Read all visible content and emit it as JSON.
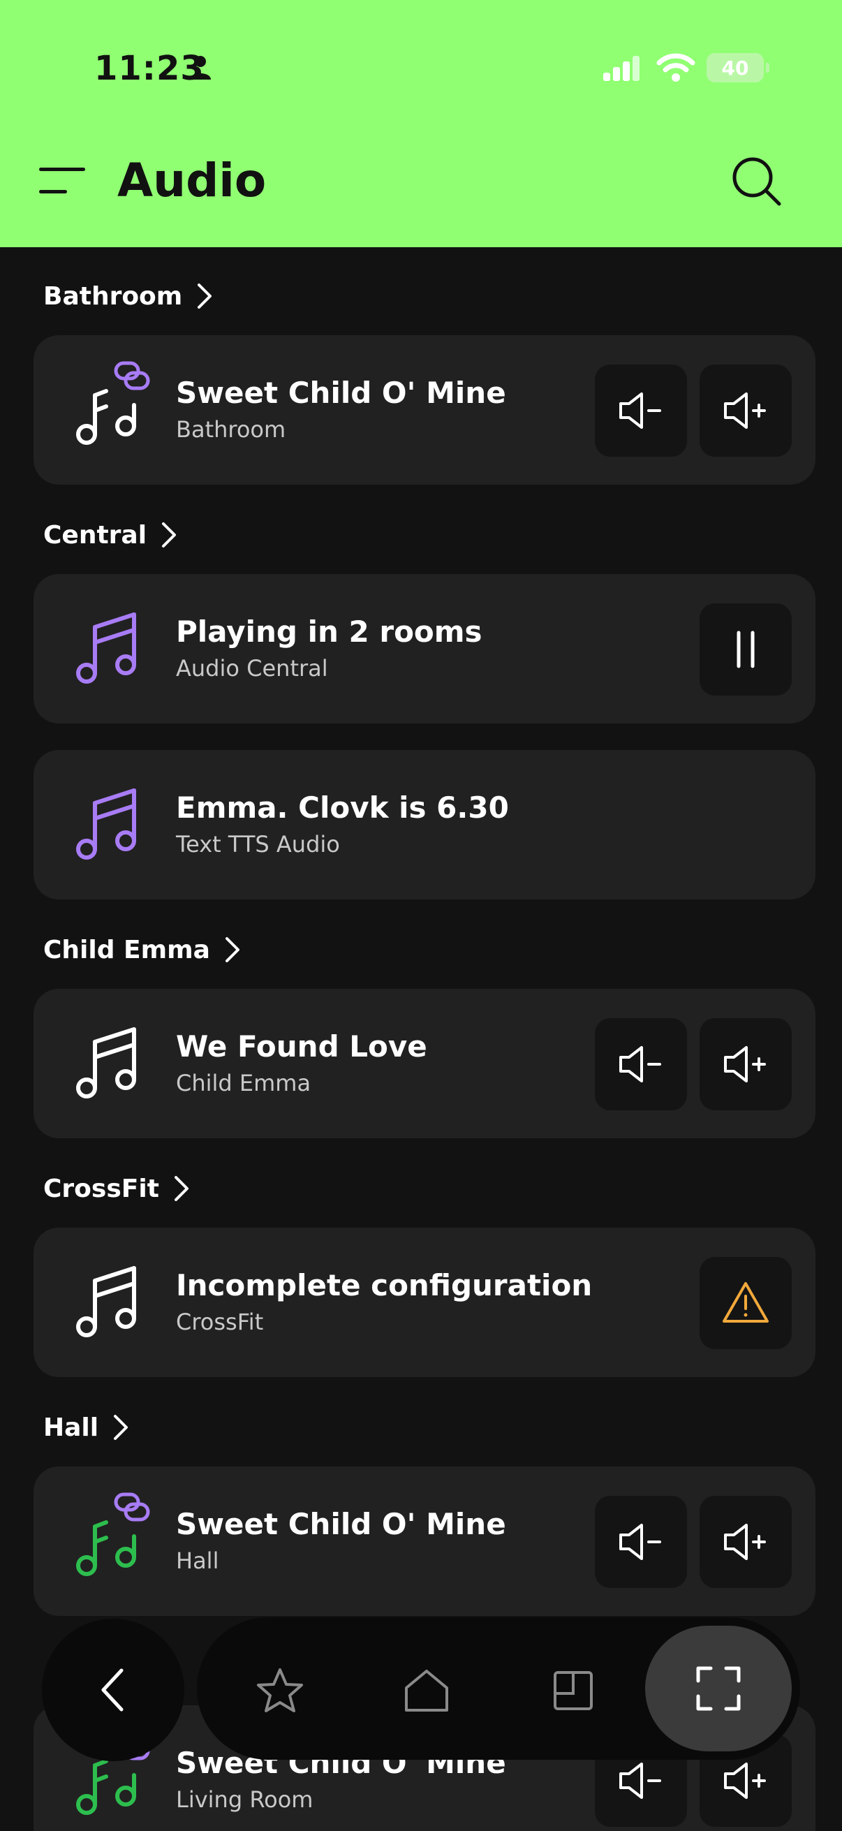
{
  "status": {
    "time": "11:23",
    "battery": "40"
  },
  "header": {
    "title": "Audio"
  },
  "sections": [
    {
      "label": "Bathroom"
    },
    {
      "label": "Central"
    },
    {
      "label": "Child Emma"
    },
    {
      "label": "CrossFit"
    },
    {
      "label": "Hall"
    }
  ],
  "cards": [
    {
      "title": "Sweet Child O' Mine",
      "subtitle": "Bathroom"
    },
    {
      "title": "Playing in 2 rooms",
      "subtitle": "Audio Central"
    },
    {
      "title": "Emma. Clovk is 6.30",
      "subtitle": "Text TTS Audio"
    },
    {
      "title": "We Found Love",
      "subtitle": "Child Emma"
    },
    {
      "title": "Incomplete configuration",
      "subtitle": "CrossFit"
    },
    {
      "title": "Sweet Child O' Mine",
      "subtitle": "Hall"
    },
    {
      "title": "Sweet Child O' Mine",
      "subtitle": "Living Room"
    }
  ],
  "colors": {
    "header_bg": "#90FF72",
    "accent_purple": "#A87CF5",
    "accent_green": "#2DBE4E",
    "warning": "#F2A93B",
    "card_bg": "#212121",
    "page_bg": "#121212"
  },
  "icons": [
    "menu-icon",
    "search-icon",
    "chevron-right-icon",
    "music-note-icon",
    "link-icon",
    "volume-down-icon",
    "volume-up-icon",
    "pause-icon",
    "warning-icon",
    "back-icon",
    "star-icon",
    "home-icon",
    "layout-icon",
    "scan-icon"
  ]
}
